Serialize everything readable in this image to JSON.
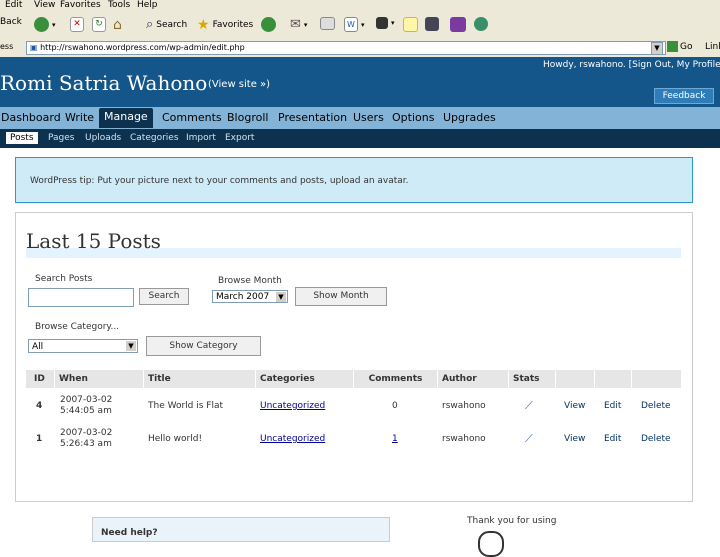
{
  "browser": {
    "menu": [
      "Edit",
      "View",
      "Favorites",
      "Tools",
      "Help"
    ],
    "toolbar": {
      "back": "Back",
      "search": "Search",
      "favorites": "Favorites"
    },
    "address_label": "ess",
    "url": "http://rswahono.wordpress.com/wp-admin/edit.php",
    "go": "Go",
    "links": "Links"
  },
  "header": {
    "blog_name": "Romi Satria Wahono",
    "view_site": "(View site »)",
    "howdy": "Howdy, rswahono. [Sign Out, My Profile]",
    "feedback": "Feedback"
  },
  "admin_menu": [
    "Dashboard",
    "Write",
    "Manage",
    "Comments",
    "Blogroll",
    "Presentation",
    "Users",
    "Options",
    "Upgrades"
  ],
  "sub_menu": [
    "Posts",
    "Pages",
    "Uploads",
    "Categories",
    "Import",
    "Export"
  ],
  "tip": "WordPress tip: Put your picture next to your comments and posts, upload an avatar.",
  "page": {
    "title": "Last 15 Posts",
    "search_label": "Search Posts",
    "search_value": "",
    "search_button": "Search",
    "month_label": "Browse Month",
    "month_value": "March 2007",
    "month_button": "Show Month",
    "category_label": "Browse Category...",
    "category_value": "All",
    "category_button": "Show Category"
  },
  "table": {
    "headers": [
      "ID",
      "When",
      "Title",
      "Categories",
      "Comments",
      "Author",
      "Stats",
      "",
      "",
      ""
    ],
    "rows": [
      {
        "id": "4",
        "date": "2007-03-02",
        "time": "5:44:05 am",
        "title": "The World is Flat",
        "category": "Uncategorized",
        "comments": "0",
        "author": "rswahono",
        "view": "View",
        "edit": "Edit",
        "delete": "Delete"
      },
      {
        "id": "1",
        "date": "2007-03-02",
        "time": "5:26:43 am",
        "title": "Hello world!",
        "category": "Uncategorized",
        "comments": "1",
        "author": "rswahono",
        "view": "View",
        "edit": "Edit",
        "delete": "Delete"
      }
    ]
  },
  "footer": {
    "need_help": "Need help?",
    "thanks": "Thank you for using"
  },
  "colors": {
    "header_bg": "#14568a",
    "menu_bg": "#83b4d8",
    "submenu_bg": "#0d324f",
    "tip_bg": "#cfebf7"
  }
}
